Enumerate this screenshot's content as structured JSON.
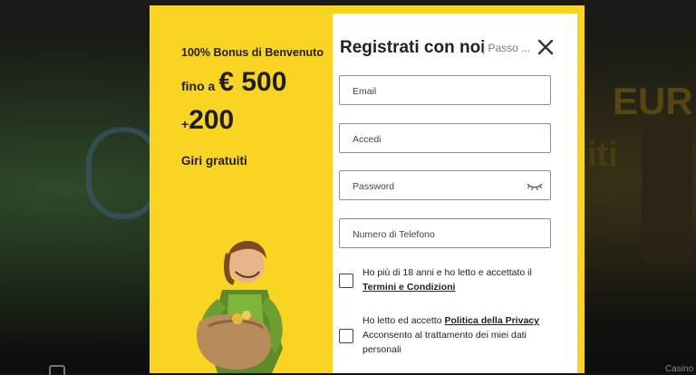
{
  "background": {
    "text_line1": "EUR",
    "text_line2": "iti",
    "bottom_right_label": "Casino"
  },
  "promo": {
    "bonus_line": "100% Bonus di Benvenuto",
    "amount_prefix": "fino a",
    "amount": "€ 500",
    "spins_prefix": "+",
    "spins_amount": "200",
    "spins_label": "Giri gratuiti"
  },
  "form": {
    "title": "Registrati con noi",
    "step_label": "| Passo  ...",
    "email_placeholder": "Email",
    "username_placeholder": "Accedi",
    "password_placeholder": "Password",
    "phone_placeholder": "Numero di Telefono",
    "age_text": "Ho più di 18 anni e ho letto e accettato il",
    "terms_link": "Termini e Condizioni",
    "privacy_text": "Ho letto ed accetto",
    "privacy_link": "Politica della Privacy",
    "consent_text": "Acconsento al trattamento dei miei dati personali"
  },
  "colors": {
    "accent": "#f9d423",
    "text": "#222222"
  },
  "icons": {
    "close": "close-icon",
    "password_toggle": "eye-closed-icon"
  }
}
